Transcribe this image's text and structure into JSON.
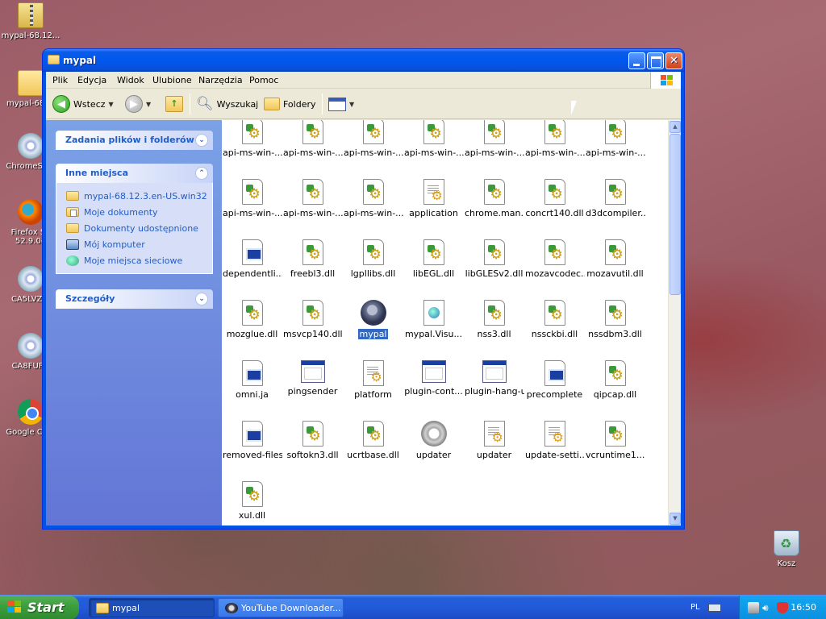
{
  "desktop": {
    "icons": [
      {
        "label": "mypal-68.12...",
        "icon": "zip-icon"
      },
      {
        "label": "mypal-68....",
        "icon": "folder-icon"
      },
      {
        "label": "ChromeSe...",
        "icon": "cd-installer-icon"
      },
      {
        "label": "Firefox Se... 52.9.0e...",
        "label_line1": "Firefox Se",
        "label_line2": "52.9.0e",
        "icon": "firefox-icon"
      },
      {
        "label": "CA5LVZ...",
        "icon": "cd-installer-icon"
      },
      {
        "label": "CA8FUF...",
        "icon": "cd-installer-icon"
      },
      {
        "label": "Google Ch...",
        "icon": "chrome-icon"
      }
    ],
    "recycle_bin_label": "Kosz"
  },
  "window": {
    "title": "mypal",
    "menu": [
      "Plik",
      "Edycja",
      "Widok",
      "Ulubione",
      "Narzędzia",
      "Pomoc"
    ],
    "toolbar": {
      "back_label": "Wstecz",
      "search_label": "Wyszukaj",
      "folders_label": "Foldery"
    },
    "left_pane": {
      "file_tasks_title": "Zadania plików i folderów",
      "other_places_title": "Inne miejsca",
      "other_places": [
        "mypal-68.12.3.en-US.win32",
        "Moje dokumenty",
        "Dokumenty udostępnione",
        "Mój komputer",
        "Moje miejsca sieciowe"
      ],
      "details_title": "Szczegóły"
    },
    "files": [
      {
        "name": "api-ms-win-...",
        "type": "dll"
      },
      {
        "name": "api-ms-win-...",
        "type": "dll"
      },
      {
        "name": "api-ms-win-...",
        "type": "dll"
      },
      {
        "name": "api-ms-win-...",
        "type": "dll"
      },
      {
        "name": "api-ms-win-...",
        "type": "dll"
      },
      {
        "name": "api-ms-win-...",
        "type": "dll"
      },
      {
        "name": "api-ms-win-...",
        "type": "dll"
      },
      {
        "name": "api-ms-win-...",
        "type": "dll"
      },
      {
        "name": "api-ms-win-...",
        "type": "dll"
      },
      {
        "name": "api-ms-win-...",
        "type": "dll"
      },
      {
        "name": "application",
        "type": "cfg"
      },
      {
        "name": "chrome.man...",
        "type": "dll"
      },
      {
        "name": "concrt140.dll",
        "type": "dll"
      },
      {
        "name": "d3dcompiler...",
        "type": "dll"
      },
      {
        "name": "dependentli...",
        "type": "ja"
      },
      {
        "name": "freebl3.dll",
        "type": "dll"
      },
      {
        "name": "lgpllibs.dll",
        "type": "dll"
      },
      {
        "name": "libEGL.dll",
        "type": "dll"
      },
      {
        "name": "libGLESv2.dll",
        "type": "dll"
      },
      {
        "name": "mozavcodec...",
        "type": "dll"
      },
      {
        "name": "mozavutil.dll",
        "type": "dll"
      },
      {
        "name": "mozglue.dll",
        "type": "dll"
      },
      {
        "name": "msvcp140.dll",
        "type": "dll"
      },
      {
        "name": "mypal",
        "type": "app",
        "selected": true
      },
      {
        "name": "mypal.Visu...",
        "type": "xml"
      },
      {
        "name": "nss3.dll",
        "type": "dll"
      },
      {
        "name": "nssckbi.dll",
        "type": "dll"
      },
      {
        "name": "nssdbm3.dll",
        "type": "dll"
      },
      {
        "name": "omni.ja",
        "type": "ja"
      },
      {
        "name": "pingsender",
        "type": "win"
      },
      {
        "name": "platform",
        "type": "cfg"
      },
      {
        "name": "plugin-cont...",
        "type": "win"
      },
      {
        "name": "plugin-hang-ui",
        "type": "win"
      },
      {
        "name": "precomplete",
        "type": "ja"
      },
      {
        "name": "qipcap.dll",
        "type": "dll"
      },
      {
        "name": "removed-files",
        "type": "ja"
      },
      {
        "name": "softokn3.dll",
        "type": "dll"
      },
      {
        "name": "ucrtbase.dll",
        "type": "dll"
      },
      {
        "name": "updater",
        "type": "upd"
      },
      {
        "name": "updater",
        "type": "cfg"
      },
      {
        "name": "update-setti...",
        "type": "cfg"
      },
      {
        "name": "vcruntime1...",
        "type": "dll"
      },
      {
        "name": "xul.dll",
        "type": "dll"
      }
    ]
  },
  "taskbar": {
    "start_label": "Start",
    "tasks": [
      {
        "label": "mypal",
        "active": true
      },
      {
        "label": "YouTube Downloader...",
        "active": false
      }
    ],
    "language": "PL",
    "clock": "16:50"
  },
  "colors": {
    "titlebar": "#0058ee",
    "selection": "#316ac5",
    "taskbar": "#245edb",
    "start": "#3c9d3c",
    "tray": "#0c8fe0",
    "link": "#215dc6"
  }
}
